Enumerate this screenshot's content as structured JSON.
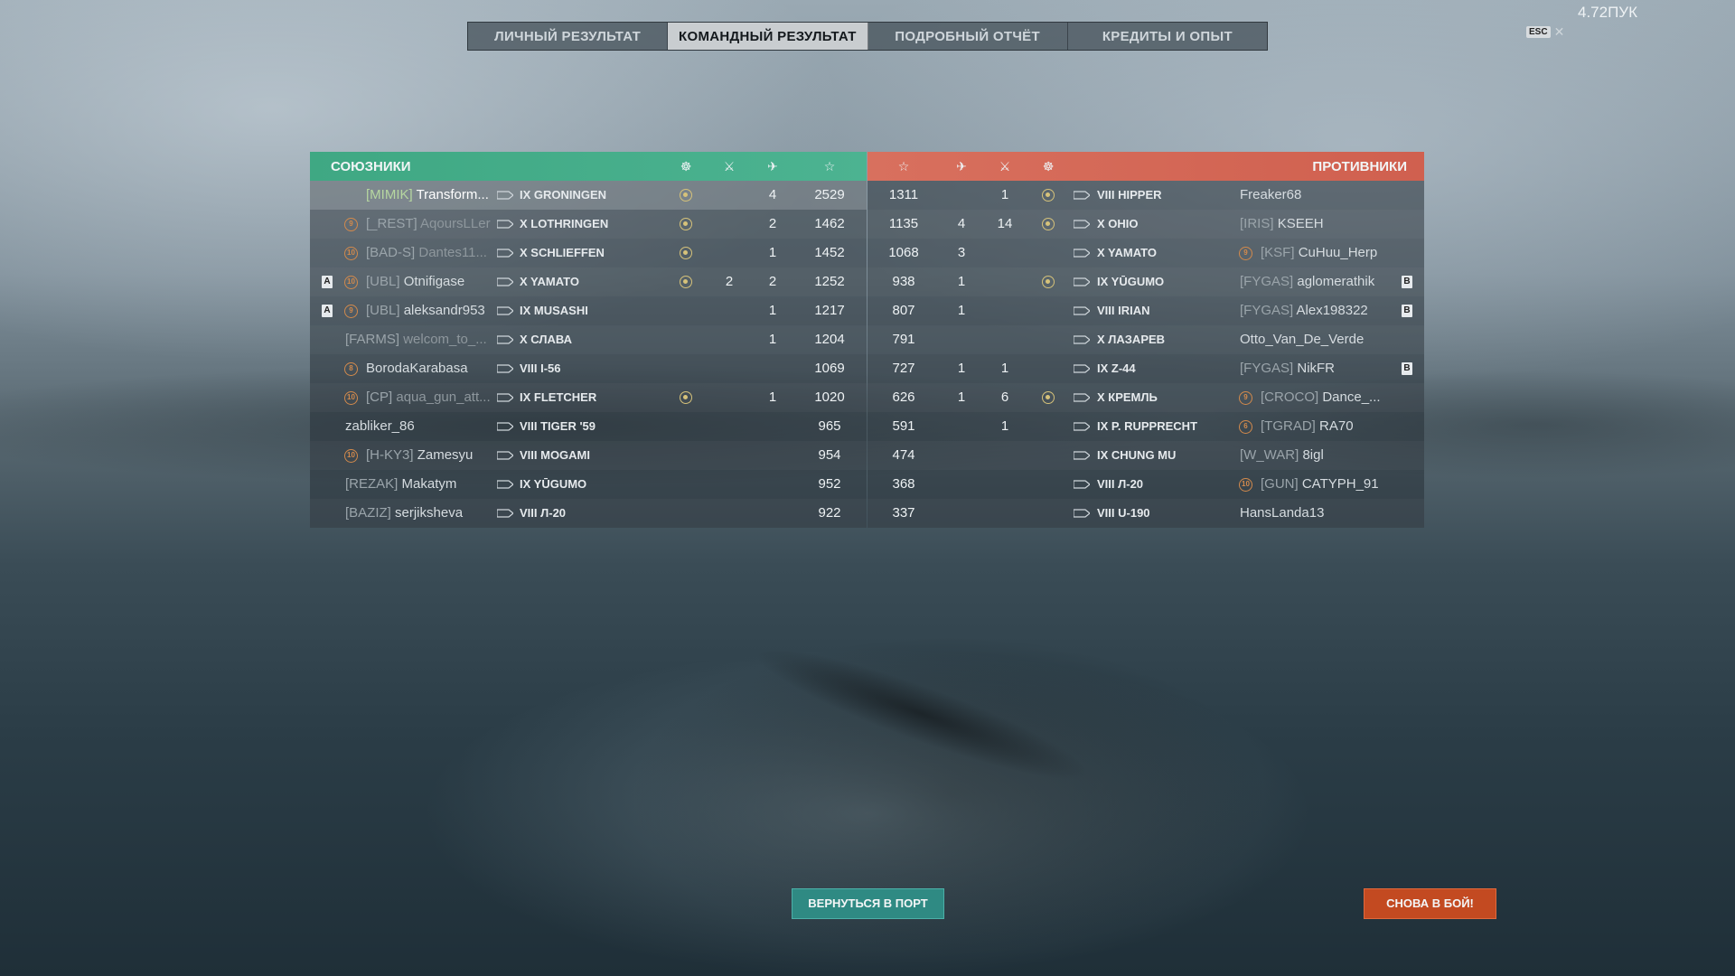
{
  "tabs": [
    "ЛИЧНЫЙ РЕЗУЛЬТАТ",
    "КОМАНДНЫЙ РЕЗУЛЬТАТ",
    "ПОДРОБНЫЙ ОТЧЁТ",
    "КРЕДИТЫ И ОПЫТ"
  ],
  "active_tab": 1,
  "ping": "4.72ПУК",
  "esc": {
    "key": "ESC",
    "close": "✕"
  },
  "allies": {
    "title": "СОЮЗНИКИ",
    "rows": [
      {
        "clan": "[MIMIK]",
        "name": "Transform...",
        "ship": "IX GRONINGEN",
        "badge": "",
        "division": "",
        "medal": true,
        "kills": "",
        "planes": "4",
        "score": "2529",
        "self": true,
        "dead": false
      },
      {
        "clan": "[_REST]",
        "name": "AqoursLLer",
        "ship": "X LOTHRINGEN",
        "badge": "9",
        "division": "",
        "medal": true,
        "kills": "",
        "planes": "2",
        "score": "1462",
        "self": false,
        "dead": true
      },
      {
        "clan": "[BAD-S]",
        "name": "Dantes11...",
        "ship": "X SCHLIEFFEN",
        "badge": "10",
        "division": "",
        "medal": true,
        "kills": "",
        "planes": "1",
        "score": "1452",
        "self": false,
        "dead": true
      },
      {
        "clan": "[UBL]",
        "name": "Otnifigase",
        "ship": "X YAMATO",
        "badge": "10",
        "division": "A",
        "medal": true,
        "kills": "2",
        "planes": "2",
        "score": "1252",
        "self": false,
        "dead": false
      },
      {
        "clan": "[UBL]",
        "name": "aleksandr953",
        "ship": "IX MUSASHI",
        "badge": "9",
        "division": "A",
        "medal": false,
        "kills": "",
        "planes": "1",
        "score": "1217",
        "self": false,
        "dead": false
      },
      {
        "clan": "[FARMS]",
        "name": "welcom_to_...",
        "ship": "X СЛАВА",
        "badge": "",
        "division": "",
        "medal": false,
        "kills": "",
        "planes": "1",
        "score": "1204",
        "self": false,
        "dead": true
      },
      {
        "clan": "",
        "name": "BorodaKarabasa",
        "ship": "VIII I-56",
        "badge": "8",
        "division": "",
        "medal": false,
        "kills": "",
        "planes": "",
        "score": "1069",
        "self": false,
        "dead": false
      },
      {
        "clan": "[CP]",
        "name": "aqua_gun_att...",
        "ship": "IX FLETCHER",
        "badge": "10",
        "division": "",
        "medal": true,
        "kills": "",
        "planes": "1",
        "score": "1020",
        "self": false,
        "dead": true
      },
      {
        "clan": "",
        "name": "zabliker_86",
        "ship": "VIII TIGER '59",
        "badge": "",
        "division": "",
        "medal": false,
        "kills": "",
        "planes": "",
        "score": "965",
        "self": false,
        "dead": false
      },
      {
        "clan": "[H-KY3]",
        "name": "Zamesyu",
        "ship": "VIII MOGAMI",
        "badge": "10",
        "division": "",
        "medal": false,
        "kills": "",
        "planes": "",
        "score": "954",
        "self": false,
        "dead": false
      },
      {
        "clan": "[REZAK]",
        "name": "Makatym",
        "ship": "IX YŪGUMO",
        "badge": "",
        "division": "",
        "medal": false,
        "kills": "",
        "planes": "",
        "score": "952",
        "self": false,
        "dead": false
      },
      {
        "clan": "[BAZIZ]",
        "name": "serjiksheva",
        "ship": "VIII Л-20",
        "badge": "",
        "division": "",
        "medal": false,
        "kills": "",
        "planes": "",
        "score": "922",
        "self": false,
        "dead": false
      }
    ]
  },
  "enemies": {
    "title": "ПРОТИВНИКИ",
    "rows": [
      {
        "score": "1311",
        "planes": "",
        "kills": "1",
        "medal": true,
        "ship": "VIII HIPPER",
        "clan": "",
        "name": "Freaker68",
        "badge": "",
        "division": ""
      },
      {
        "score": "1135",
        "planes": "4",
        "kills": "14",
        "medal": true,
        "ship": "X OHIO",
        "clan": "[IRIS]",
        "name": "KSEEH",
        "badge": "",
        "division": ""
      },
      {
        "score": "1068",
        "planes": "3",
        "kills": "",
        "medal": false,
        "ship": "X YAMATO",
        "clan": "[KSF]",
        "name": "CuHuu_Herp",
        "badge": "9",
        "division": ""
      },
      {
        "score": "938",
        "planes": "1",
        "kills": "",
        "medal": true,
        "ship": "IX YŪGUMO",
        "clan": "[FYGAS]",
        "name": "aglomerathik",
        "badge": "",
        "division": "B"
      },
      {
        "score": "807",
        "planes": "1",
        "kills": "",
        "medal": false,
        "ship": "VIII IRIAN",
        "clan": "[FYGAS]",
        "name": "Alex198322",
        "badge": "",
        "division": "B"
      },
      {
        "score": "791",
        "planes": "",
        "kills": "",
        "medal": false,
        "ship": "X ЛАЗАРЕВ",
        "clan": "",
        "name": "Otto_Van_De_Verde",
        "badge": "",
        "division": ""
      },
      {
        "score": "727",
        "planes": "1",
        "kills": "1",
        "medal": false,
        "ship": "IX Z-44",
        "clan": "[FYGAS]",
        "name": "NikFR",
        "badge": "",
        "division": "B"
      },
      {
        "score": "626",
        "planes": "1",
        "kills": "6",
        "medal": true,
        "ship": "X КРЕМЛЬ",
        "clan": "[CROCO]",
        "name": "Dance_...",
        "badge": "9",
        "division": ""
      },
      {
        "score": "591",
        "planes": "",
        "kills": "1",
        "medal": false,
        "ship": "IX P. RUPPRECHT",
        "clan": "[TGRAD]",
        "name": "RA70",
        "badge": "6",
        "division": ""
      },
      {
        "score": "474",
        "planes": "",
        "kills": "",
        "medal": false,
        "ship": "IX CHUNG MU",
        "clan": "[W_WAR]",
        "name": "8igl",
        "badge": "",
        "division": ""
      },
      {
        "score": "368",
        "planes": "",
        "kills": "",
        "medal": false,
        "ship": "VIII Л-20",
        "clan": "[GUN]",
        "name": "CATYPH_91",
        "badge": "10",
        "division": ""
      },
      {
        "score": "337",
        "planes": "",
        "kills": "",
        "medal": false,
        "ship": "VIII U-190",
        "clan": "",
        "name": "HansLanda13",
        "badge": "",
        "division": ""
      }
    ]
  },
  "buttons": {
    "port": "ВЕРНУТЬСЯ В ПОРТ",
    "fight": "СНОВА В БОЙ!"
  },
  "colors": {
    "allies": "#4cb391",
    "enemies": "#d0604f",
    "port_button": "#2f8a83",
    "fight_button": "#c34a21"
  },
  "icons": {
    "medal": "laurel-medal-icon",
    "kills": "crossed-swords-icon",
    "planes": "plane-icon",
    "score": "star-icon"
  }
}
